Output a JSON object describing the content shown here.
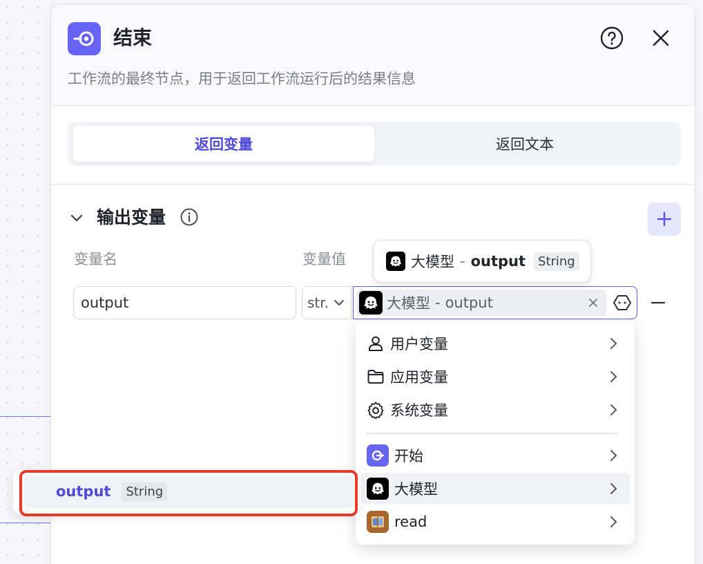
{
  "panel": {
    "title": "结束",
    "description": "工作流的最终节点，用于返回工作流运行后的结果信息"
  },
  "tabs": [
    {
      "label": "返回变量",
      "active": true
    },
    {
      "label": "返回文本",
      "active": false
    }
  ],
  "output_section": {
    "title": "输出变量",
    "col_name": "变量名",
    "col_value": "变量值",
    "row": {
      "name": "output",
      "type": "str.",
      "ref_node": "大模型",
      "ref_sep": "-",
      "ref_var": "output"
    }
  },
  "tooltip": {
    "node": "大模型",
    "sep": "-",
    "var": "output",
    "type": "String"
  },
  "dropdown": {
    "items": [
      {
        "label": "用户变量",
        "icon": "user-icon"
      },
      {
        "label": "应用变量",
        "icon": "folder-icon"
      },
      {
        "label": "系统变量",
        "icon": "gear-icon"
      },
      {
        "label": "开始",
        "icon": "start-node-icon"
      },
      {
        "label": "大模型",
        "icon": "llm-node-icon",
        "highlighted": true
      },
      {
        "label": "read",
        "icon": "book-node-icon"
      }
    ]
  },
  "submenu": {
    "name": "output",
    "type": "String"
  },
  "colors": {
    "accent": "#4d4bd8",
    "node_icon": "#6764f5",
    "highlight": "#e63b28"
  }
}
